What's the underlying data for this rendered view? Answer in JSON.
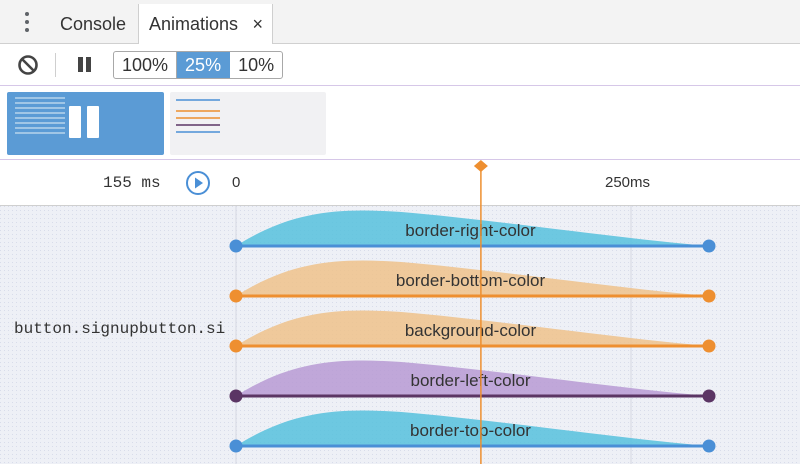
{
  "tabs": {
    "menu_icon": "kebab-menu-icon",
    "items": [
      {
        "label": "Console",
        "active": false
      },
      {
        "label": "Animations",
        "active": true,
        "close_label": "×"
      }
    ]
  },
  "toolbar": {
    "clear_icon": "clear-all-icon",
    "pause_icon": "pause-icon",
    "playback_rates": [
      {
        "label": "100%",
        "selected": false
      },
      {
        "label": "25%",
        "selected": true
      },
      {
        "label": "10%",
        "selected": false
      }
    ]
  },
  "buffer": {
    "groups": [
      {
        "selected": true,
        "icon": "animation-group-preview"
      },
      {
        "selected": false,
        "icon": "animation-group-preview"
      }
    ]
  },
  "timeline": {
    "current_time": "155 ms",
    "replay_icon": "replay-icon",
    "ticks": [
      {
        "label": "0",
        "ms": 0
      },
      {
        "label": "250ms",
        "ms": 250
      }
    ],
    "scrubber_ms": 155,
    "node_label": "button.signupbutton.si",
    "animations": [
      {
        "name": "border-right-color",
        "color": "#56c1dd",
        "line": "#4a8fd6",
        "handle": "#4a8fd6"
      },
      {
        "name": "border-bottom-color",
        "color": "#efc28b",
        "line": "#ee8f30",
        "handle": "#ee8f30"
      },
      {
        "name": "background-color",
        "color": "#efc28b",
        "line": "#ee8f30",
        "handle": "#ee8f30"
      },
      {
        "name": "border-left-color",
        "color": "#b79ad3",
        "line": "#5b3564",
        "handle": "#5b3564"
      },
      {
        "name": "border-top-color",
        "color": "#56c1dd",
        "line": "#4a8fd6",
        "handle": "#4a8fd6"
      }
    ]
  },
  "colors": {
    "accent": "#5b9bd5",
    "scrubber": "#ee8f30"
  }
}
